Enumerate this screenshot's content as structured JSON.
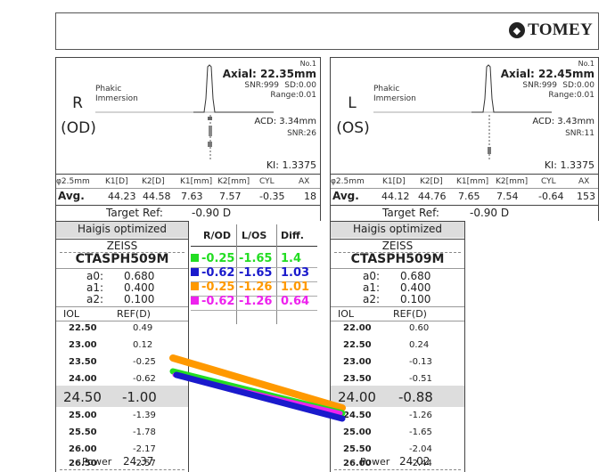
{
  "header": {
    "brand": "TOMEY",
    "logo_icon": "tomey-logo"
  },
  "left": {
    "eye_label": "R",
    "eye_code": "(OD)",
    "mode1": "Phakic",
    "mode2": "Immersion",
    "no": "No.1",
    "axial": "Axial: 22.35mm",
    "snr": "SNR:999",
    "sd": "SD:0.00",
    "range": "Range:0.01",
    "acd": "ACD: 3.34mm",
    "acd_snr": "SNR:26",
    "ki": "KI: 1.3375",
    "k_headers": [
      "φ2.5mm",
      "K1[D]",
      "K2[D]",
      "K1[mm]",
      "K2[mm]",
      "CYL",
      "AX"
    ],
    "k_values": [
      "Avg.",
      "44.23",
      "44.58",
      "7.63",
      "7.57",
      "-0.35",
      "18"
    ],
    "target_label": "Target Ref:",
    "target_value": "-0.90 D",
    "formula": "Haigis optimized",
    "manufacturer": "ZEISS",
    "lens": "CTASPH509M",
    "constants": [
      [
        "a0:",
        "0.680"
      ],
      [
        "a1:",
        "0.400"
      ],
      [
        "a2:",
        "0.100"
      ]
    ],
    "iol_header": "IOL",
    "ref_header": "REF(D)",
    "rows": [
      [
        "22.50",
        "0.49"
      ],
      [
        "23.00",
        "0.12"
      ],
      [
        "23.50",
        "-0.25"
      ],
      [
        "24.00",
        "-0.62"
      ],
      [
        "24.50",
        "-1.00"
      ],
      [
        "25.00",
        "-1.39"
      ],
      [
        "25.50",
        "-1.78"
      ],
      [
        "26.00",
        "-2.17"
      ],
      [
        "26.50",
        "-2.57"
      ]
    ],
    "power_label": "Power",
    "power_value": "24.37"
  },
  "right": {
    "eye_label": "L",
    "eye_code": "(OS)",
    "mode1": "Phakic",
    "mode2": "Immersion",
    "no": "No.1",
    "axial": "Axial: 22.45mm",
    "snr": "SNR:999",
    "sd": "SD:0.00",
    "range": "Range:0.01",
    "acd": "ACD: 3.43mm",
    "acd_snr": "SNR:11",
    "ki": "KI: 1.3375",
    "k_headers": [
      "φ2.5mm",
      "K1[D]",
      "K2[D]",
      "K1[mm]",
      "K2[mm]",
      "CYL",
      "AX"
    ],
    "k_values": [
      "Avg.",
      "44.12",
      "44.76",
      "7.65",
      "7.54",
      "-0.64",
      "153"
    ],
    "target_label": "Target Ref:",
    "target_value": "-0.90 D",
    "formula": "Haigis optimized",
    "manufacturer": "ZEISS",
    "lens": "CTASPH509M",
    "constants": [
      [
        "a0:",
        "0.680"
      ],
      [
        "a1:",
        "0.400"
      ],
      [
        "a2:",
        "0.100"
      ]
    ],
    "iol_header": "IOL",
    "ref_header": "REF(D)",
    "rows": [
      [
        "22.00",
        "0.60"
      ],
      [
        "22.50",
        "0.24"
      ],
      [
        "23.00",
        "-0.13"
      ],
      [
        "23.50",
        "-0.51"
      ],
      [
        "24.00",
        "-0.88"
      ],
      [
        "24.50",
        "-1.26"
      ],
      [
        "25.00",
        "-1.65"
      ],
      [
        "25.50",
        "-2.04"
      ],
      [
        "26.00",
        "-2.44"
      ]
    ],
    "power_label": "Power",
    "power_value": "24.02"
  },
  "compare": {
    "headers": [
      "R/OD",
      "L/OS",
      "Diff."
    ],
    "rows": [
      {
        "color": "#22dd22",
        "od": "-0.25",
        "os": "-1.65",
        "diff": "1.4"
      },
      {
        "color": "#1a1acc",
        "od": "-0.62",
        "os": "-1.65",
        "diff": "1.03"
      },
      {
        "color": "#ff9900",
        "od": "-0.25",
        "os": "-1.26",
        "diff": "1.01"
      },
      {
        "color": "#ee22ee",
        "od": "-0.62",
        "os": "-1.26",
        "diff": "0.64"
      }
    ]
  }
}
